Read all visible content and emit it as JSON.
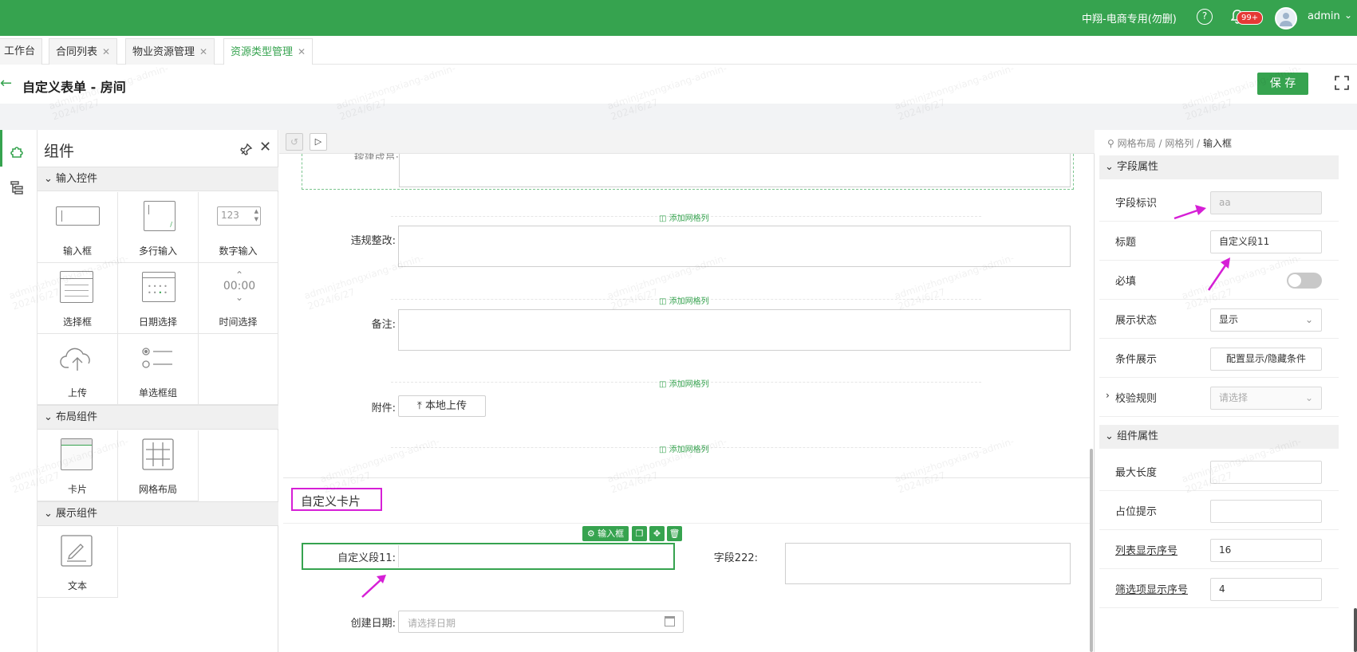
{
  "topbar": {
    "org": "中翔-电商专用(勿删)",
    "badge": "99+",
    "user": "admin"
  },
  "tabs": [
    {
      "label": "工作台"
    },
    {
      "label": "合同列表"
    },
    {
      "label": "物业资源管理"
    },
    {
      "label": "资源类型管理"
    }
  ],
  "header": {
    "title": "自定义表单 - 房间",
    "save": "保 存"
  },
  "panel": {
    "title": "组件",
    "sections": {
      "input": "输入控件",
      "layout": "布局组件",
      "display": "展示组件"
    },
    "items": {
      "input_box": "输入框",
      "textarea": "多行输入",
      "number": "数字输入",
      "number_preview": "123",
      "select": "选择框",
      "date": "日期选择",
      "time": "时间选择",
      "time_preview": "00:00",
      "upload": "上传",
      "radio": "单选框组",
      "card": "卡片",
      "grid": "网格布局",
      "text": "文本"
    }
  },
  "canvas": {
    "partial_label": "稼建成员:",
    "violation_label": "违规整改:",
    "remark_label": "备注:",
    "attach_label": "附件:",
    "upload_button": "本地上传",
    "add_col": "添加网格列",
    "card_title": "自定义卡片",
    "field11_label": "自定义段11:",
    "field222_label": "字段222:",
    "date_label": "创建日期:",
    "date_placeholder": "请选择日期",
    "toolbar_tag": "输入框"
  },
  "props": {
    "breadcrumb": [
      "网格布局",
      "网格列",
      "输入框"
    ],
    "field_section": "字段属性",
    "component_section": "组件属性",
    "rows": {
      "id_label": "字段标识",
      "id_value": "aa",
      "title_label": "标题",
      "title_value": "自定义段11",
      "required_label": "必填",
      "display_label": "展示状态",
      "display_value": "显示",
      "cond_label": "条件展示",
      "cond_button": "配置显示/隐藏条件",
      "validate_label": "校验规则",
      "validate_placeholder": "请选择",
      "maxlen_label": "最大长度",
      "placeholder_label": "占位提示",
      "list_order_label": "列表显示序号",
      "list_order_value": "16",
      "filter_order_label": "筛选项显示序号",
      "filter_order_value": "4"
    }
  },
  "watermark": {
    "line1": "adminjzhongxiang-admin-",
    "line2": "2024/6/27"
  },
  "colors": {
    "brand": "#36a34f",
    "highlight": "#d61fd6"
  }
}
